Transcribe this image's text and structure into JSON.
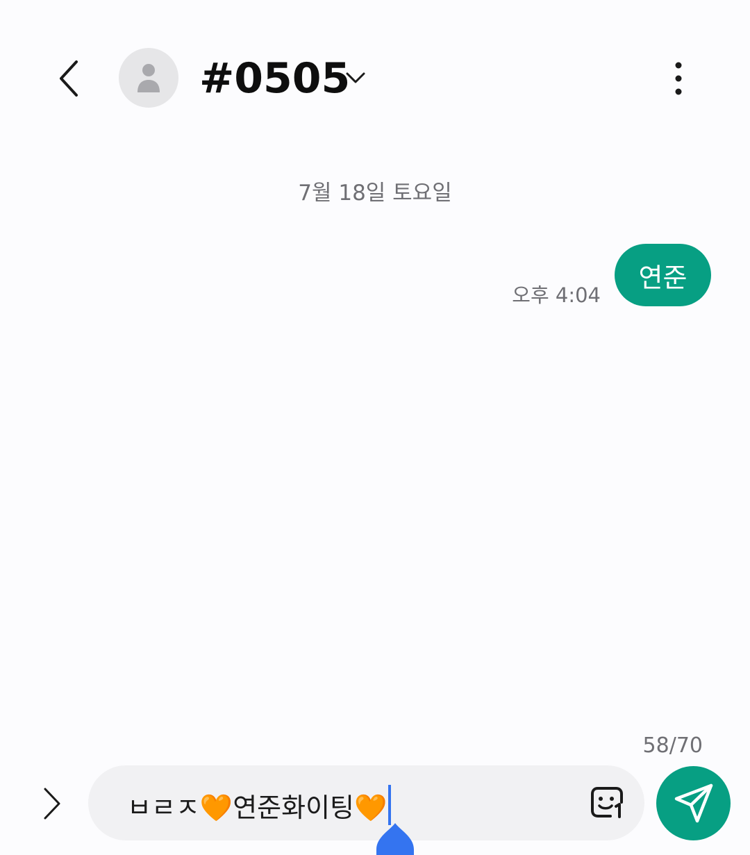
{
  "header": {
    "title": "#0505",
    "back_icon": "chevron-left-icon",
    "avatar_icon": "person-icon",
    "dropdown_icon": "chevron-down-icon",
    "more_icon": "more-vertical-icon"
  },
  "conversation": {
    "date_separator": "7월 18일 토요일",
    "messages": [
      {
        "direction": "outgoing",
        "text": "연준",
        "time": "오후 4:04"
      }
    ]
  },
  "composer": {
    "char_counter": "58/70",
    "input_value": "ㅂㄹㅈ🧡연준화이팅🧡",
    "expand_icon": "chevron-right-icon",
    "emoji_icon": "sticker-icon",
    "send_icon": "send-icon"
  },
  "colors": {
    "accent": "#079f83",
    "cursor": "#3474f0",
    "background": "#fcfcfe",
    "input_bg": "#f1f1f3",
    "secondary_text": "#6f6f74"
  }
}
